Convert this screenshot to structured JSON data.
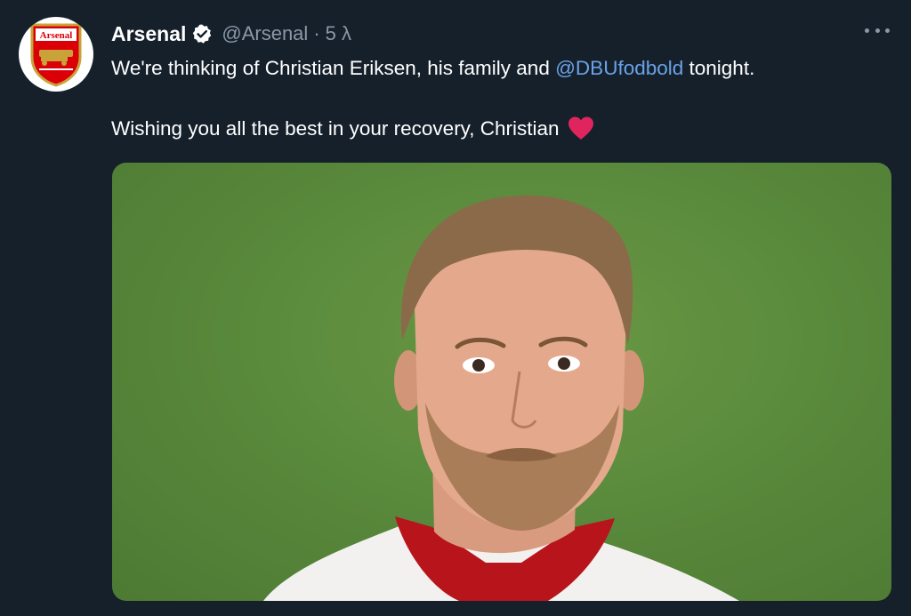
{
  "tweet": {
    "display_name": "Arsenal",
    "handle": "@Arsenal",
    "separator": "·",
    "time": "5 λ",
    "avatar_crest_text": "Arsenal",
    "text_line1_before": "We're thinking of Christian Eriksen, his family and ",
    "mention": "@DBUfodbold",
    "text_line1_after": " tonight.",
    "text_line2": "Wishing you all the best in your recovery, Christian",
    "icons": {
      "verified": "verified-badge-icon",
      "heart": "red-heart-icon",
      "more": "more-options-icon"
    }
  },
  "colors": {
    "background": "#15202b",
    "name": "#ffffff",
    "secondary": "#8b98a5",
    "mention": "#6aa2e8",
    "heart": "#e0245e",
    "verified_badge": "#ffffff",
    "arsenal_red": "#db0007"
  }
}
